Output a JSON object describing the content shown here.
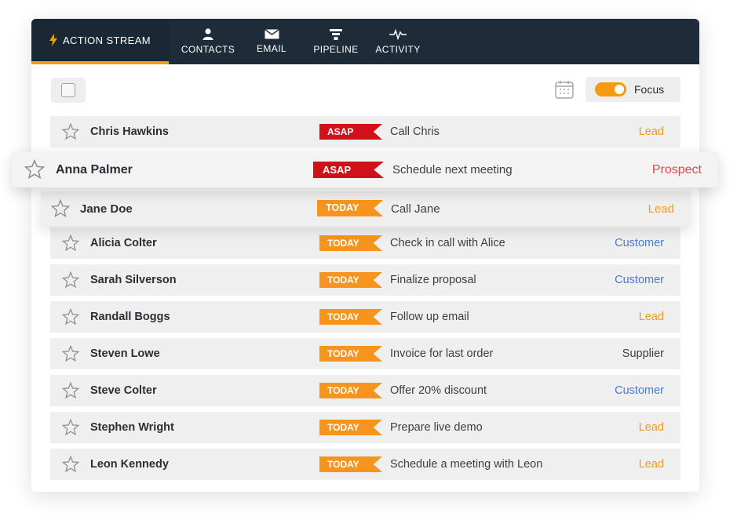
{
  "nav": {
    "tabs": [
      {
        "label": "ACTION STREAM",
        "icon": "lightning-icon",
        "active": true
      },
      {
        "label": "CONTACTS",
        "icon": "person-icon",
        "active": false
      },
      {
        "label": "EMAIL",
        "icon": "envelope-icon",
        "active": false
      },
      {
        "label": "PIPELINE",
        "icon": "funnel-icon",
        "active": false
      },
      {
        "label": "ACTIVITY",
        "icon": "pulse-icon",
        "active": false
      }
    ]
  },
  "toolbar": {
    "select_all_checked": false,
    "calendar_icon": "calendar-icon",
    "focus_label": "Focus",
    "focus_enabled": true
  },
  "colors": {
    "nav_bg": "#1e2b38",
    "accent": "#f39c12",
    "asap": "#d0111a",
    "today": "#f7941d",
    "lead": "#f39c12",
    "customer": "#4a7bc8",
    "prospect": "#e0454a",
    "supplier": "#3a3f44"
  },
  "rows": [
    {
      "name": "Chris Hawkins",
      "tag": "ASAP",
      "task": "Call Chris",
      "type": "Lead"
    },
    {
      "name": "Anna Palmer",
      "tag": "ASAP",
      "task": "Schedule next meeting",
      "type": "Prospect"
    },
    {
      "name": "Jane Doe",
      "tag": "TODAY",
      "task": "Call Jane",
      "type": "Lead"
    },
    {
      "name": "Alicia Colter",
      "tag": "TODAY",
      "task": "Check in call with Alice",
      "type": "Customer"
    },
    {
      "name": "Sarah Silverson",
      "tag": "TODAY",
      "task": "Finalize proposal",
      "type": "Customer"
    },
    {
      "name": "Randall Boggs",
      "tag": "TODAY",
      "task": "Follow up email",
      "type": "Lead"
    },
    {
      "name": "Steven Lowe",
      "tag": "TODAY",
      "task": "Invoice for last order",
      "type": "Supplier"
    },
    {
      "name": "Steve Colter",
      "tag": "TODAY",
      "task": "Offer 20% discount",
      "type": "Customer"
    },
    {
      "name": "Stephen Wright",
      "tag": "TODAY",
      "task": "Prepare live demo",
      "type": "Lead"
    },
    {
      "name": "Leon Kennedy",
      "tag": "TODAY",
      "task": "Schedule a meeting with Leon",
      "type": "Lead"
    }
  ]
}
